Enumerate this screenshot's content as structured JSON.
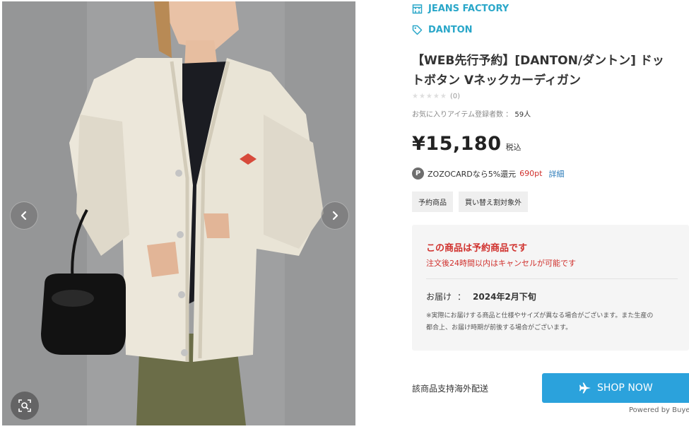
{
  "gallery": {
    "prev_icon": "chevron-left-icon",
    "next_icon": "chevron-right-icon",
    "zoom_icon": "zoom-search-icon"
  },
  "shop": {
    "store_icon": "store-icon",
    "store_name": "JEANS FACTORY",
    "brand_icon": "tag-icon",
    "brand_name": "DANTON"
  },
  "product": {
    "title_line1": "【WEB先行予約】[DANTON/ダントン] ドッ",
    "title_line2": "トボタン Vネックカーディガン",
    "stars": "★★★★★",
    "rating_count": "(0)",
    "favorite_label": "お気に入りアイテム登録者数 ：",
    "favorite_count": "59人",
    "price": "¥15,180",
    "tax_label": "税込",
    "card_icon": "P",
    "card_text": "ZOZOCARDなら5%還元",
    "card_points": "690pt",
    "card_detail_link": "詳細",
    "tags": [
      "予約商品",
      "買い替え割対象外"
    ]
  },
  "notice": {
    "heading": "この商品は予約商品です",
    "subtext": "注文後24時間以内はキャンセルが可能です",
    "delivery_label": "お届け",
    "delivery_sep": "：",
    "delivery_date": "2024年2月下旬",
    "note_line1": "※実際にお届けする商品と仕様やサイズが異なる場合がございます。また生産の",
    "note_line2": "都合上、お届け時期が前後する場合がございます。"
  },
  "shipping": {
    "overseas_label": "該商品支持海外配送",
    "shop_now_icon": "airplane-icon",
    "shop_now_label": "SHOP NOW",
    "powered_by": "Powered by Buye"
  },
  "colors": {
    "accent_blue": "#2aa7c9",
    "button_blue": "#2ba2dc",
    "alert_red": "#d0312d"
  }
}
